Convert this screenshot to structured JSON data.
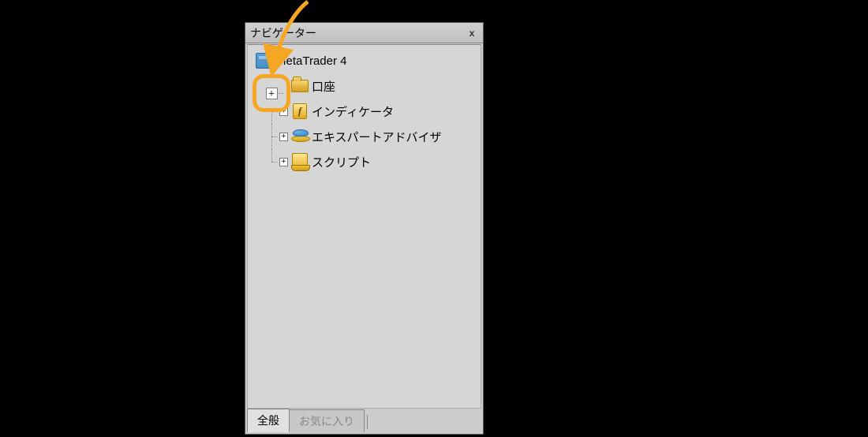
{
  "panel": {
    "title": "ナビゲーター",
    "close": "x"
  },
  "tree": {
    "root": "MetaTrader 4",
    "items": [
      {
        "label": "口座"
      },
      {
        "label": "インディケータ"
      },
      {
        "label": "エキスパートアドバイザ"
      },
      {
        "label": "スクリプト"
      }
    ]
  },
  "tabs": {
    "general": "全般",
    "favorites": "お気に入り"
  },
  "expand_symbol": "+"
}
